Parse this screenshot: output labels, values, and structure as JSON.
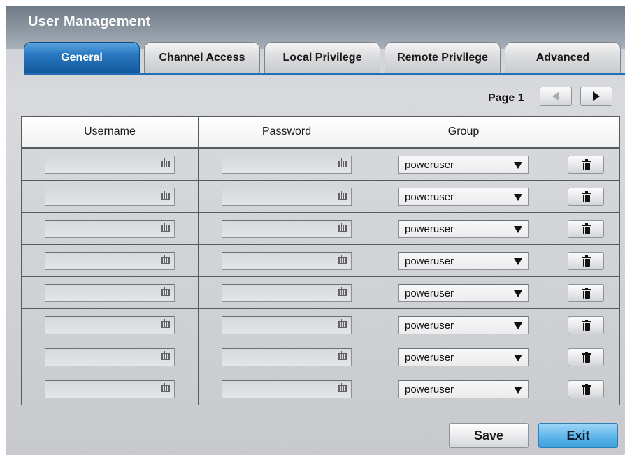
{
  "window": {
    "title": "User Management"
  },
  "tabs": [
    {
      "label": "General",
      "active": true
    },
    {
      "label": "Channel Access",
      "active": false
    },
    {
      "label": "Local Privilege",
      "active": false
    },
    {
      "label": "Remote Privilege",
      "active": false
    },
    {
      "label": "Advanced",
      "active": false
    }
  ],
  "pager": {
    "label": "Page 1",
    "prev_icon": "triangle-left-icon",
    "next_icon": "triangle-right-icon"
  },
  "table": {
    "columns": [
      "Username",
      "Password",
      "Group",
      ""
    ],
    "rows": [
      {
        "username": "",
        "password": "",
        "group": "poweruser"
      },
      {
        "username": "",
        "password": "",
        "group": "poweruser"
      },
      {
        "username": "",
        "password": "",
        "group": "poweruser"
      },
      {
        "username": "",
        "password": "",
        "group": "poweruser"
      },
      {
        "username": "",
        "password": "",
        "group": "poweruser"
      },
      {
        "username": "",
        "password": "",
        "group": "poweruser"
      },
      {
        "username": "",
        "password": "",
        "group": "poweruser"
      },
      {
        "username": "",
        "password": "",
        "group": "poweruser"
      }
    ]
  },
  "footer": {
    "save_label": "Save",
    "exit_label": "Exit"
  },
  "colors": {
    "active_tab": "#2a78c2",
    "exit_button": "#5fb6ea",
    "title_bar": "#8d97a2"
  }
}
